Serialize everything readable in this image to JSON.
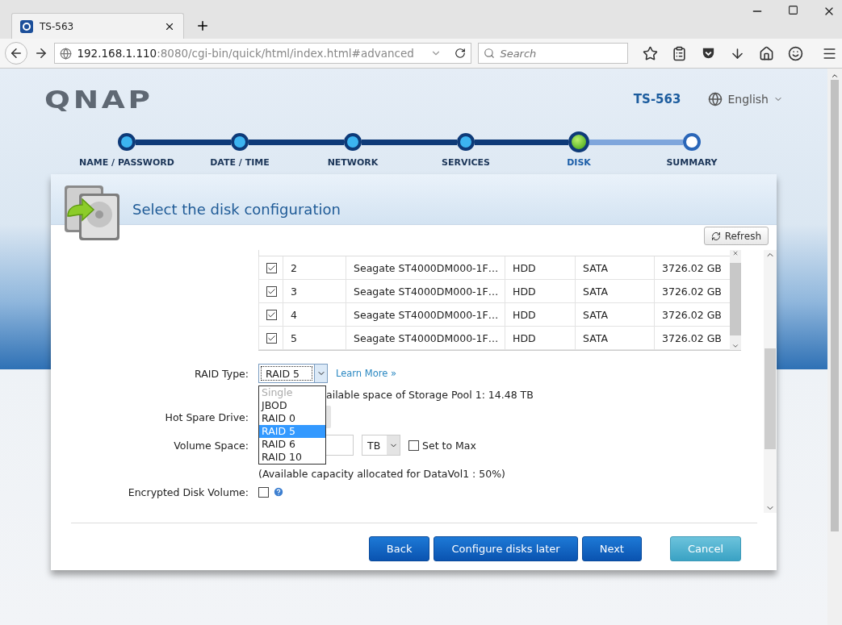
{
  "browser": {
    "tab_title": "TS-563",
    "url_host": "192.168.1.110",
    "url_rest": ":8080/cgi-bin/quick/html/index.html#advanced",
    "search_placeholder": "Search"
  },
  "header": {
    "logo": "QNAP",
    "model": "TS-563",
    "language": "English"
  },
  "steps": [
    {
      "label": "NAME / PASSWORD",
      "done": true,
      "selected": false
    },
    {
      "label": "DATE / TIME",
      "done": true,
      "selected": false
    },
    {
      "label": "NETWORK",
      "done": true,
      "selected": false
    },
    {
      "label": "SERVICES",
      "done": true,
      "selected": false
    },
    {
      "label": "DISK",
      "done": false,
      "selected": true
    },
    {
      "label": "SUMMARY",
      "done": false,
      "selected": false
    }
  ],
  "card": {
    "title": "Select the disk configuration",
    "refresh": "Refresh"
  },
  "disks": [
    {
      "checked": true,
      "number": "2",
      "model": "Seagate ST4000DM000-1F…",
      "type": "HDD",
      "bus": "SATA",
      "capacity": "3726.02 GB"
    },
    {
      "checked": true,
      "number": "3",
      "model": "Seagate ST4000DM000-1F…",
      "type": "HDD",
      "bus": "SATA",
      "capacity": "3726.02 GB"
    },
    {
      "checked": true,
      "number": "4",
      "model": "Seagate ST4000DM000-1F…",
      "type": "HDD",
      "bus": "SATA",
      "capacity": "3726.02 GB"
    },
    {
      "checked": true,
      "number": "5",
      "model": "Seagate ST4000DM000-1F…",
      "type": "HDD",
      "bus": "SATA",
      "capacity": "3726.02 GB"
    }
  ],
  "form": {
    "raid_type": {
      "label": "RAID Type:",
      "value": "RAID 5",
      "link": "Learn More »",
      "options": [
        {
          "label": "Single",
          "disabled": true,
          "selected": false
        },
        {
          "label": "JBOD",
          "disabled": false,
          "selected": false
        },
        {
          "label": "RAID 0",
          "disabled": false,
          "selected": false
        },
        {
          "label": "RAID 5",
          "disabled": false,
          "selected": true
        },
        {
          "label": "RAID 6",
          "disabled": false,
          "selected": false
        },
        {
          "label": "RAID 10",
          "disabled": false,
          "selected": false
        }
      ]
    },
    "pool_space": "ailable space of Storage Pool 1: 14.48 TB",
    "hot_spare": {
      "label": "Hot Spare Drive:"
    },
    "volume_space": {
      "label": "Volume Space:",
      "unit": "TB",
      "set_to_max": {
        "label": "Set to Max",
        "checked": false
      },
      "note": "(Available capacity allocated for DataVol1 : 50%)"
    },
    "encrypted": {
      "label": "Encrypted Disk Volume:",
      "checked": false
    }
  },
  "buttons": [
    {
      "label": "Back",
      "kind": "primary"
    },
    {
      "label": "Configure disks later",
      "kind": "primary"
    },
    {
      "label": "Next",
      "kind": "primary"
    },
    {
      "label": "Cancel",
      "kind": "secondary"
    }
  ]
}
